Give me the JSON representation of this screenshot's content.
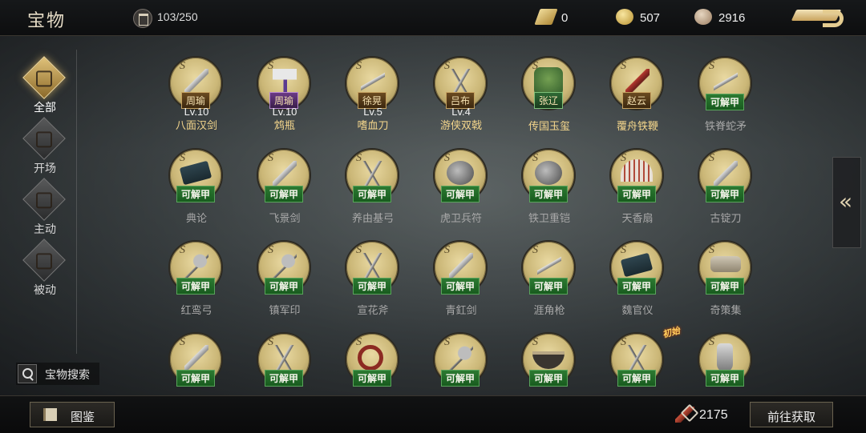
{
  "header": {
    "title": "宝物",
    "capacity": "103/250",
    "currencies": [
      {
        "icon": "gold-ingot-icon",
        "value": "0"
      },
      {
        "icon": "gold-coin-icon",
        "value": "507"
      },
      {
        "icon": "copper-coin-icon",
        "value": "2916"
      }
    ],
    "back_icon": "back-arrow-icon"
  },
  "sidebar": {
    "items": [
      {
        "label": "全部",
        "icon": "all-icon",
        "active": true
      },
      {
        "label": "开场",
        "icon": "opening-icon",
        "active": false
      },
      {
        "label": "主动",
        "icon": "active-skill-icon",
        "active": false
      },
      {
        "label": "被动",
        "icon": "passive-skill-icon",
        "active": false
      }
    ]
  },
  "search": {
    "label": "宝物搜索",
    "icon": "search-icon"
  },
  "rarity_mark": "S",
  "items": [
    {
      "name": "八面汉剑",
      "hero": "周瑜",
      "level": "Lv.10",
      "owned": true,
      "art": "blade",
      "hero_color": "gold"
    },
    {
      "name": "鸩瓶",
      "hero": "周瑜",
      "level": "Lv.10",
      "owned": true,
      "art": "flag",
      "hero_color": "purple"
    },
    {
      "name": "嗜血刀",
      "hero": "徐晃",
      "level": "Lv.5",
      "owned": true,
      "art": "spear",
      "hero_color": "gold"
    },
    {
      "name": "游侠双戟",
      "hero": "吕布",
      "level": "Lv.4",
      "owned": true,
      "art": "halberd",
      "hero_color": "gold"
    },
    {
      "name": "传国玉玺",
      "hero": "张辽",
      "level": "",
      "owned": true,
      "art": "seal",
      "hero_color": "green"
    },
    {
      "name": "覆舟铁鞭",
      "hero": "赵云",
      "level": "",
      "owned": true,
      "art": "whip",
      "hero_color": "gold"
    },
    {
      "name": "铁脊蛇矛",
      "unlock": "可解甲",
      "owned": false,
      "art": "spear"
    },
    {
      "name": "典论",
      "unlock": "可解甲",
      "owned": false,
      "art": "box"
    },
    {
      "name": "飞景剑",
      "unlock": "可解甲",
      "owned": false,
      "art": "blade"
    },
    {
      "name": "养由基弓",
      "unlock": "可解甲",
      "owned": false,
      "art": "halberd"
    },
    {
      "name": "虎卫兵符",
      "unlock": "可解甲",
      "owned": false,
      "art": "round"
    },
    {
      "name": "铁卫重铠",
      "unlock": "可解甲",
      "owned": false,
      "art": "round"
    },
    {
      "name": "天香扇",
      "unlock": "可解甲",
      "owned": false,
      "art": "fan"
    },
    {
      "name": "古锭刀",
      "unlock": "可解甲",
      "owned": false,
      "art": "blade"
    },
    {
      "name": "红鸾弓",
      "unlock": "可解甲",
      "owned": false,
      "art": "mace"
    },
    {
      "name": "镇军印",
      "unlock": "可解甲",
      "owned": false,
      "art": "mace"
    },
    {
      "name": "宣花斧",
      "unlock": "可解甲",
      "owned": false,
      "art": "halberd"
    },
    {
      "name": "青釭剑",
      "unlock": "可解甲",
      "owned": false,
      "art": "blade"
    },
    {
      "name": "涯角枪",
      "unlock": "可解甲",
      "owned": false,
      "art": "spear"
    },
    {
      "name": "魏官仪",
      "unlock": "可解甲",
      "owned": false,
      "art": "box"
    },
    {
      "name": "奇策集",
      "unlock": "可解甲",
      "owned": false,
      "art": "scroll"
    },
    {
      "name": "",
      "unlock": "可解甲",
      "owned": false,
      "art": "blade"
    },
    {
      "name": "",
      "unlock": "可解甲",
      "owned": false,
      "art": "halberd"
    },
    {
      "name": "",
      "unlock": "可解甲",
      "owned": false,
      "art": "ring"
    },
    {
      "name": "",
      "unlock": "可解甲",
      "owned": false,
      "art": "mace"
    },
    {
      "name": "",
      "unlock": "可解甲",
      "owned": false,
      "art": "bowl"
    },
    {
      "name": "",
      "unlock": "可解甲",
      "owned": false,
      "art": "halberd",
      "badge": "初始"
    },
    {
      "name": "",
      "unlock": "可解甲",
      "owned": false,
      "art": "vase"
    }
  ],
  "expand_icon": "double-chevron-left-icon",
  "footer": {
    "guide_label": "图鉴",
    "guide_icon": "book-icon",
    "resource_value": "2175",
    "resource_icon": "arrow-token-icon",
    "get_label": "前往获取"
  }
}
